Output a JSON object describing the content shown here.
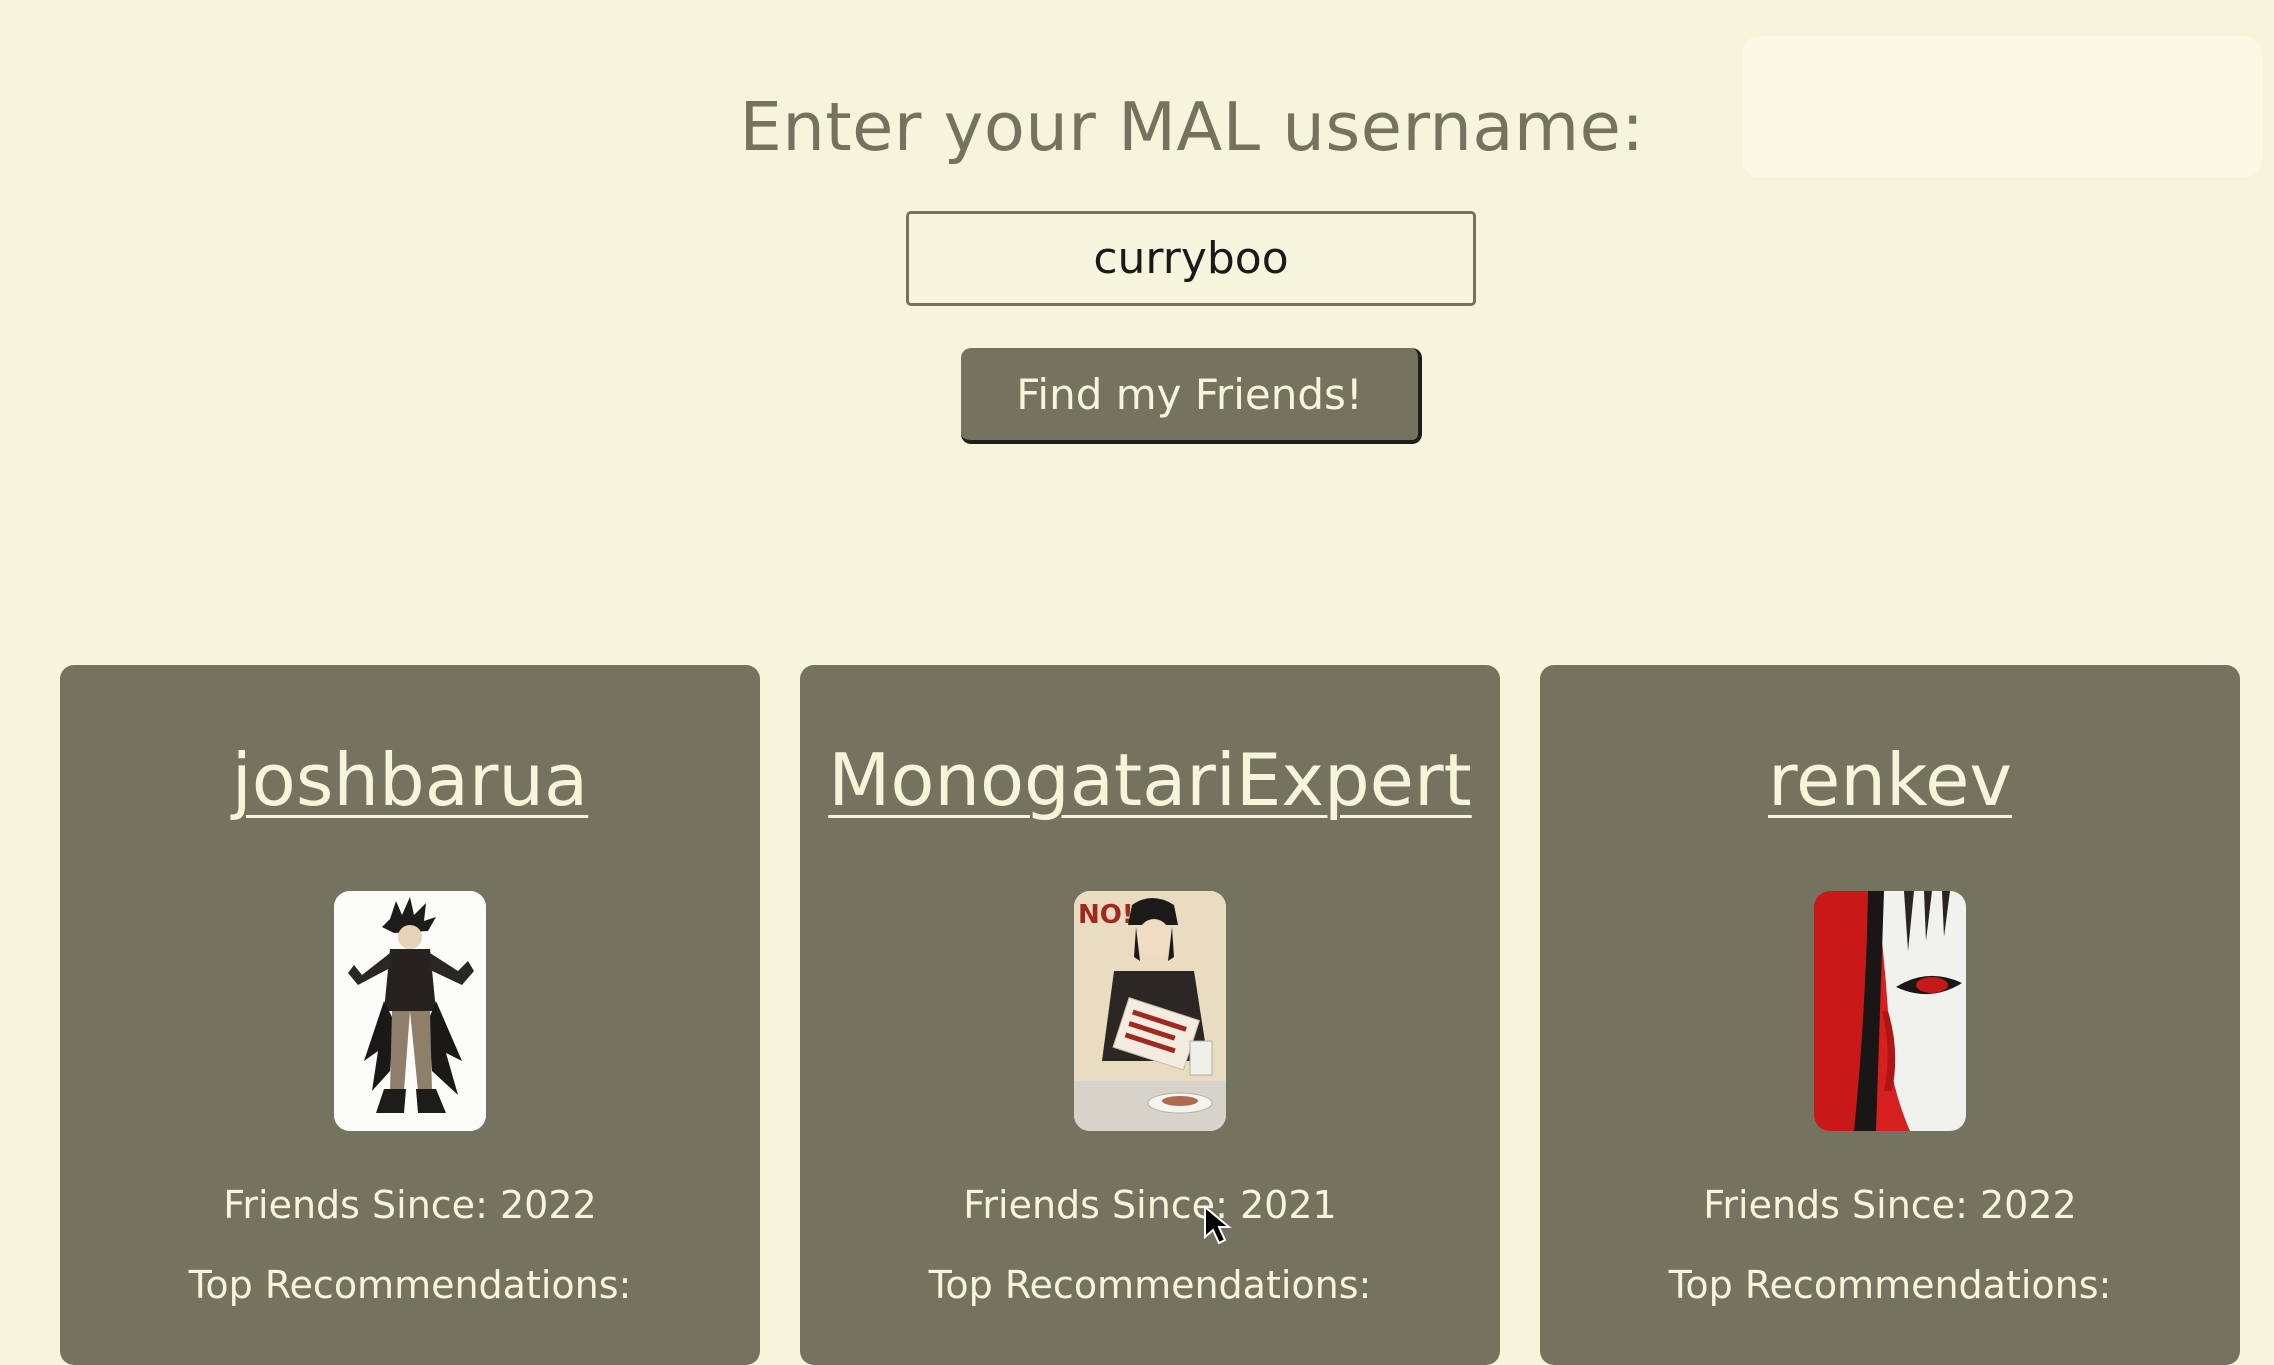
{
  "header": {
    "prompt": "Enter your MAL username:",
    "username_value": "curryboo",
    "submit_label": "Find my Friends!"
  },
  "friends": [
    {
      "name": "joshbarua",
      "avatar_icon": "anime-character-dark-hair-avatar",
      "since_label": "Friends Since:",
      "since_year": "2022",
      "recs_label": "Top Recommendations:"
    },
    {
      "name": "MonogatariExpert",
      "avatar_icon": "anime-character-newspaper-avatar",
      "avatar_text": "NO!",
      "since_label": "Friends Since:",
      "since_year": "2021",
      "recs_label": "Top Recommendations:"
    },
    {
      "name": "renkev",
      "avatar_icon": "anime-character-red-eye-avatar",
      "since_label": "Friends Since:",
      "since_year": "2022",
      "recs_label": "Top Recommendations:"
    }
  ],
  "colors": {
    "background": "#f5f5dc",
    "accent": "#74735f",
    "text_light": "#f5f5dc"
  }
}
